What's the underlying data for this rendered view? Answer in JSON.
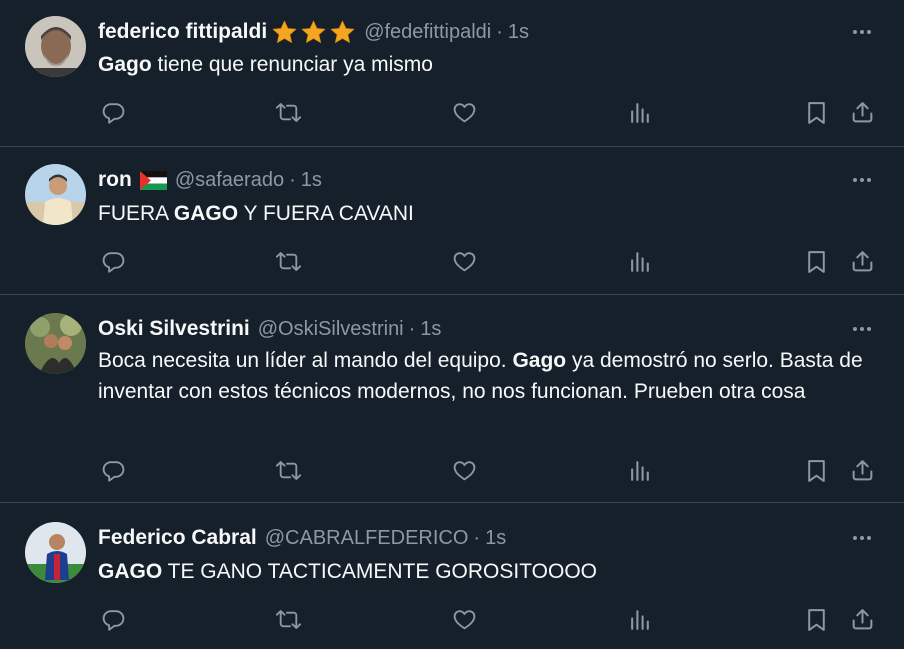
{
  "tweets": [
    {
      "name": "federico fittipaldi",
      "badges": [
        "star-icon",
        "star-icon",
        "star-icon"
      ],
      "handle": "@fedefittipaldi",
      "dot": "·",
      "time": "1s",
      "text_bold": "Gago",
      "text_rest": " tiene que renunciar ya mismo"
    },
    {
      "name": "ron",
      "badges": [
        "palestine-flag-icon"
      ],
      "handle": "@safaerado",
      "dot": "·",
      "time": "1s",
      "text_pre": "FUERA ",
      "text_bold": "GAGO",
      "text_rest": " Y FUERA CAVANI"
    },
    {
      "name": "Oski Silvestrini",
      "handle": "@OskiSilvestrini",
      "dot": "·",
      "time": "1s",
      "text_pre": "Boca necesita un líder al mando del equipo. ",
      "text_bold": "Gago",
      "text_rest": " ya demostró no serlo. Basta de inventar con estos técnicos modernos, no nos funcionan. Prueben otra cosa"
    },
    {
      "name": "Federico Cabral",
      "handle": "@CABRALFEDERICO",
      "dot": "·",
      "time": "1s",
      "text_bold": "GAGO",
      "text_rest": " TE GANO TACTICAMENTE GOROSITOOOO"
    }
  ],
  "colors": {
    "background": "#15202b",
    "text": "#f7f9f9",
    "secondary": "#8b98a5",
    "divider": "#38444d",
    "star": "#f4a522",
    "icon": "#8b98a5"
  },
  "action_icons": [
    "reply-icon",
    "retweet-icon",
    "like-icon",
    "views-icon",
    "bookmark-icon",
    "share-icon"
  ],
  "more_icon": "more-options-icon"
}
